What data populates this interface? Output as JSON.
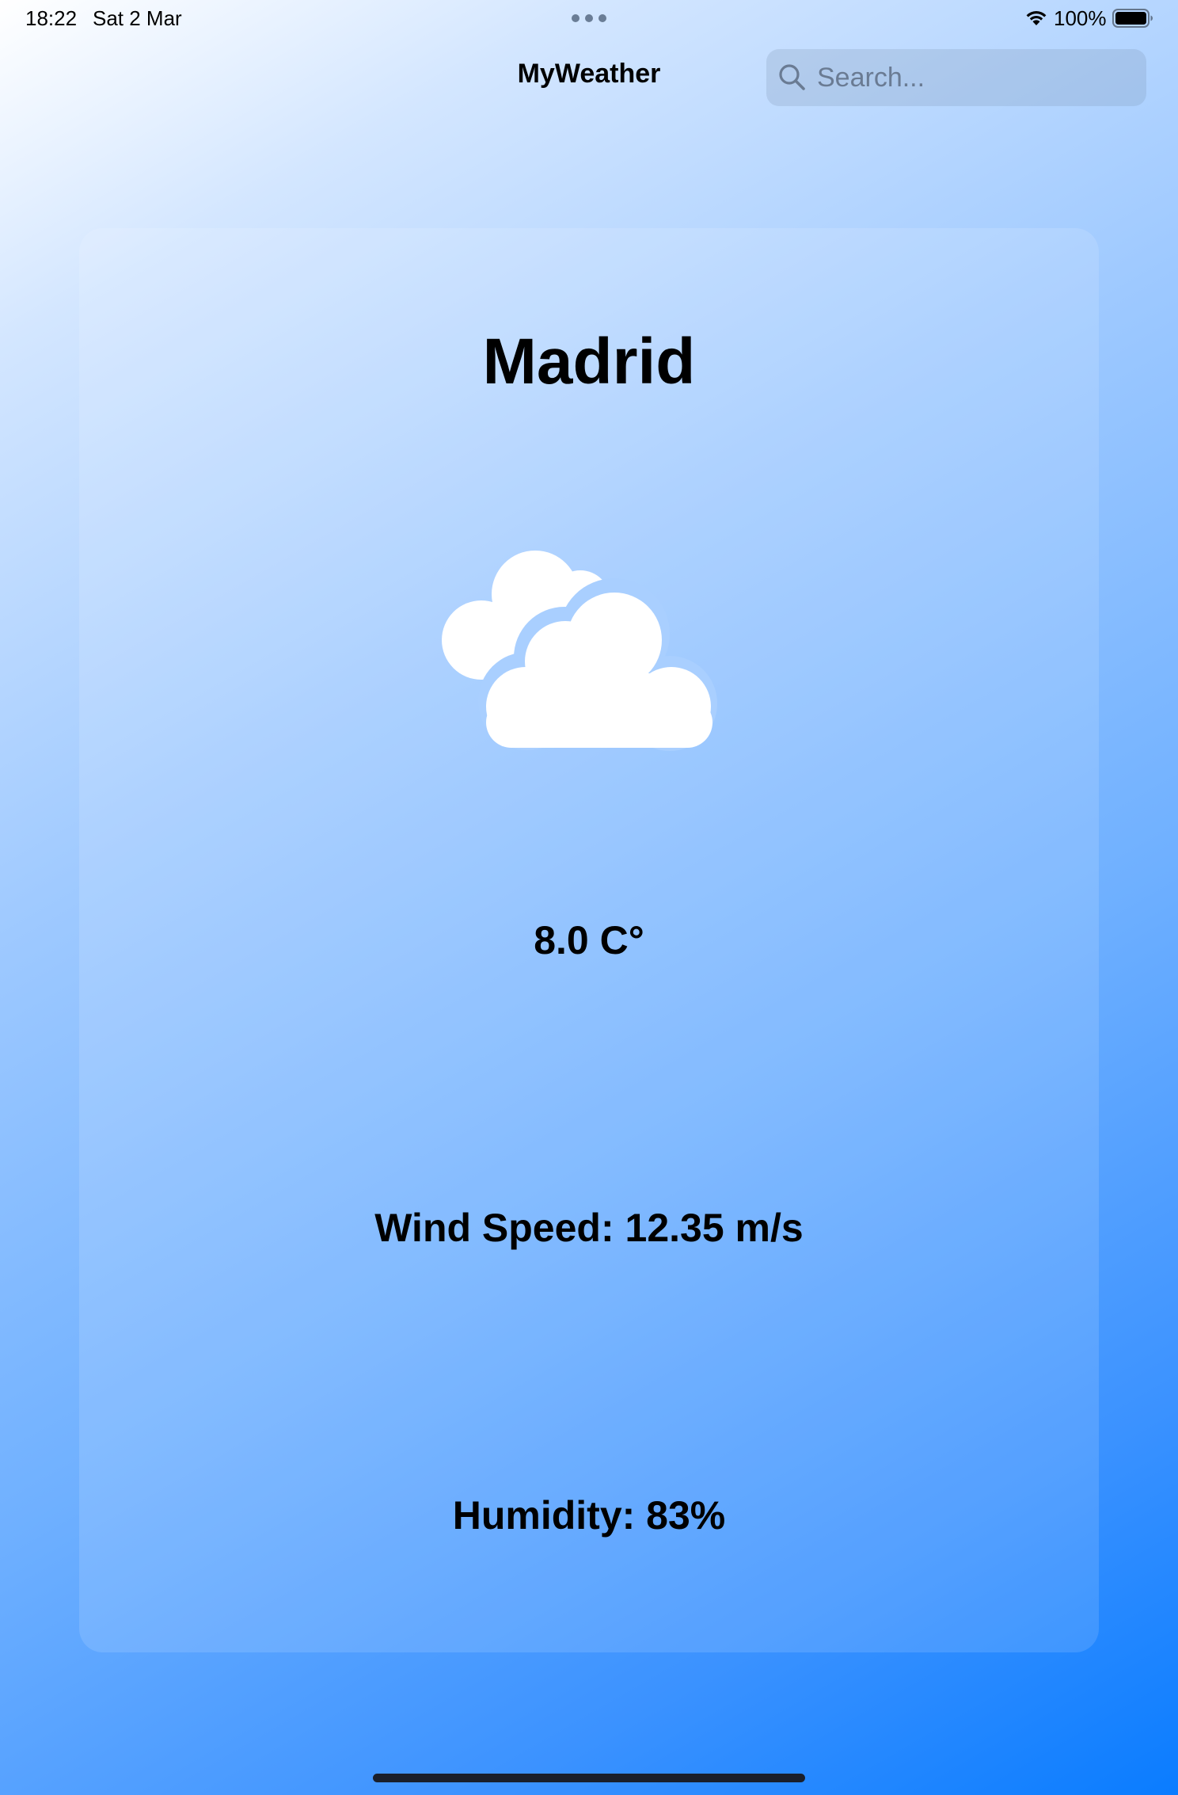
{
  "status_bar": {
    "time": "18:22",
    "date": "Sat 2 Mar",
    "battery_percent": "100%",
    "wifi_icon": "wifi-icon",
    "battery_icon": "battery-full-icon",
    "multitask_icon": "ellipsis-icon"
  },
  "nav": {
    "title": "MyWeather",
    "search": {
      "placeholder": "Search...",
      "value": "",
      "icon": "search-icon"
    }
  },
  "weather": {
    "city": "Madrid",
    "condition_icon": "cloudy-icon",
    "temperature": "8.0 C°",
    "wind_speed": "Wind Speed: 12.35 m/s",
    "humidity": "Humidity: 83%"
  },
  "colors": {
    "background_start": "#ffffff",
    "background_end": "#0a7cff",
    "text": "#000000",
    "placeholder": "#6a7b93",
    "icon_fill": "#ffffff"
  }
}
